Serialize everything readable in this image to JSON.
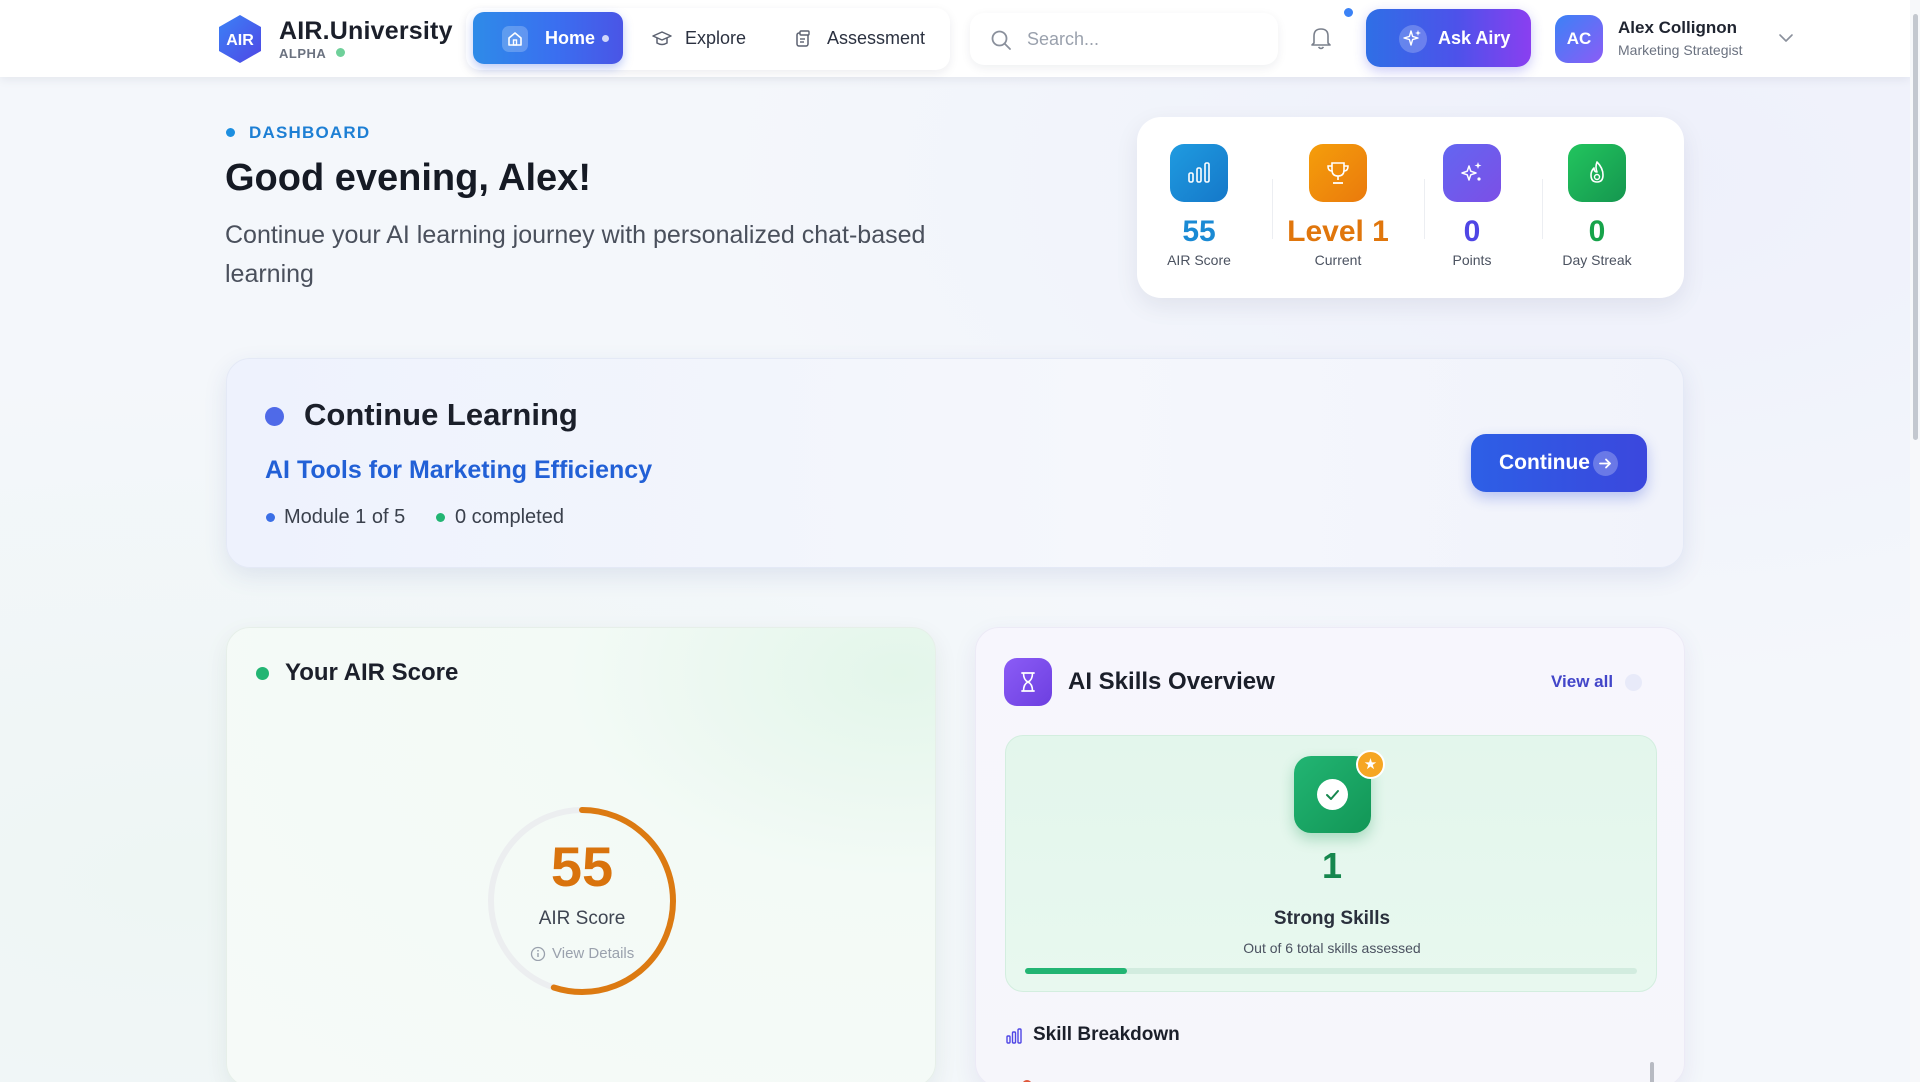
{
  "brand": {
    "logo_text": "AIR",
    "name": "AIR.University",
    "stage": "ALPHA"
  },
  "nav": {
    "home": "Home",
    "explore": "Explore",
    "assessment": "Assessment"
  },
  "search": {
    "placeholder": "Search..."
  },
  "header_actions": {
    "ask_label": "Ask Airy"
  },
  "user": {
    "initials": "AC",
    "name": "Alex Collignon",
    "role": "Marketing Strategist"
  },
  "hero": {
    "eyebrow": "DASHBOARD",
    "greeting": "Good evening, Alex!",
    "subline": "Continue your AI learning journey with personalized chat-based learning"
  },
  "stats": [
    {
      "value": "55",
      "caption": "AIR Score",
      "color": "#1a8ad4",
      "icon": "bar-chart-icon"
    },
    {
      "value": "Level 1",
      "caption": "Current",
      "color": "#e0760c",
      "icon": "trophy-icon"
    },
    {
      "value": "0",
      "caption": "Points",
      "color": "#4f46e5",
      "icon": "sparkles-icon"
    },
    {
      "value": "0",
      "caption": "Day Streak",
      "color": "#16a34a",
      "icon": "flame-icon"
    }
  ],
  "continue_learning": {
    "title": "Continue Learning",
    "course": "AI Tools for Marketing Efficiency",
    "module": "Module 1 of 5",
    "completed": "0 completed",
    "button": "Continue"
  },
  "air_score": {
    "title": "Your AIR Score",
    "value": "55",
    "caption": "AIR Score",
    "link": "View Details",
    "percent": 55
  },
  "skills": {
    "title": "AI Skills Overview",
    "view_all": "View all",
    "strong_count": "1",
    "strong_label": "Strong Skills",
    "note": "Out of 6 total skills assessed",
    "strong_fraction": 0.1667,
    "breakdown_title": "Skill Breakdown"
  }
}
